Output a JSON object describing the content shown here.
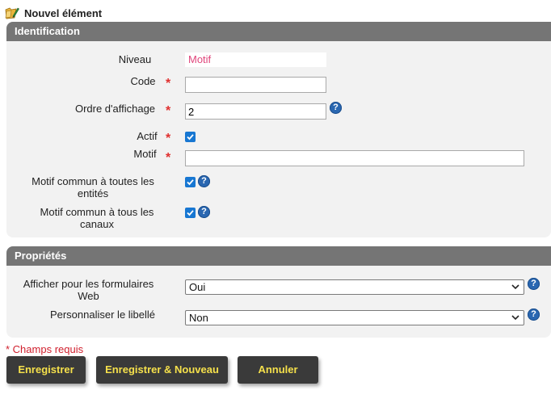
{
  "header": {
    "title": "Nouvel élément",
    "icon": "folder-edit-icon"
  },
  "identification": {
    "title": "Identification",
    "niveau": {
      "label": "Niveau",
      "value": "Motif"
    },
    "code": {
      "label": "Code",
      "required_mark": "*",
      "value": ""
    },
    "ordre": {
      "label": "Ordre d'affichage",
      "required_mark": "*",
      "value": "2"
    },
    "actif": {
      "label": "Actif",
      "required_mark": "*",
      "checked": true
    },
    "motif": {
      "label": "Motif",
      "required_mark": "*",
      "value": ""
    },
    "commun_entites": {
      "label": "Motif commun à toutes les entités",
      "checked": true
    },
    "commun_canaux": {
      "label": "Motif commun à tous les canaux",
      "checked": true
    }
  },
  "proprietes": {
    "title": "Propriétés",
    "afficher_web": {
      "label": "Afficher pour les formulaires Web",
      "value": "Oui"
    },
    "personnaliser": {
      "label": "Personnaliser le libellé",
      "value": "Non"
    }
  },
  "help_glyph": "?",
  "required_note": "* Champs requis",
  "buttons": {
    "save": "Enregistrer",
    "save_new": "Enregistrer & Nouveau",
    "cancel": "Annuler"
  },
  "colors": {
    "section_header": "#757575",
    "required": "#e0302f",
    "button_bg": "#3a3a3a",
    "button_text": "#f5e04b",
    "checkbox": "#1877d2"
  }
}
